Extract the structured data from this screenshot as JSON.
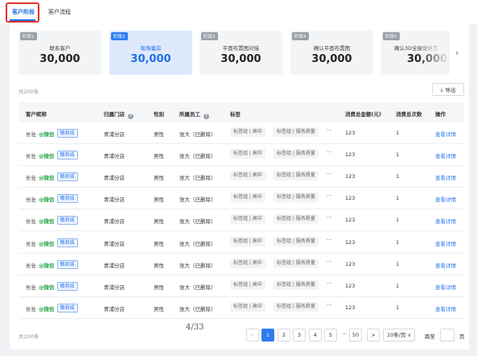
{
  "tabs": [
    {
      "label": "客户阶段",
      "active": true
    },
    {
      "label": "客户流程",
      "active": false
    }
  ],
  "stages": [
    {
      "chip": "阶段1",
      "name": "联系客户",
      "count": "30,000"
    },
    {
      "chip": "阶段2",
      "name": "现场量房",
      "count": "30,000"
    },
    {
      "chip": "阶段3",
      "name": "平面布置图对接",
      "count": "30,000"
    },
    {
      "chip": "阶段4",
      "name": "确认平面布置图",
      "count": "30,000"
    },
    {
      "chip": "阶段5",
      "name": "确认3D全屋设计方",
      "count": "30,000"
    }
  ],
  "scroll_right_icon": "chevron-right-icon",
  "total_top": "共200条",
  "export_label": "导出",
  "export_icon": "download-icon",
  "columns": {
    "customer": "客户昵称",
    "store": "归属门店",
    "gender": "性别",
    "staff": "所属员工",
    "tags": "标签",
    "amount": "消费总金额(元)",
    "times": "消费总次数",
    "action": "操作"
  },
  "rows": [
    {
      "name": "长壮",
      "channel": "@微信",
      "tag": "徽商城",
      "store": "青浦分店",
      "gender": "男性",
      "staff": "张大（已删除）",
      "tag1": "标签组 | 高中",
      "tag2": "标签组 | 服务质量",
      "more": "···",
      "amount": "123",
      "times": "1",
      "action": "查看详情"
    },
    {
      "name": "长壮",
      "channel": "@微信",
      "tag": "徽商城",
      "store": "青浦分店",
      "gender": "男性",
      "staff": "张大（已删除）",
      "tag1": "标签组 | 高中",
      "tag2": "标签组 | 服务质量",
      "more": "···",
      "amount": "123",
      "times": "1",
      "action": "查看详情"
    },
    {
      "name": "长壮",
      "channel": "@微信",
      "tag": "徽商城",
      "store": "青浦分店",
      "gender": "男性",
      "staff": "张大（已删除）",
      "tag1": "标签组 | 高中",
      "tag2": "标签组 | 服务质量",
      "more": "···",
      "amount": "123",
      "times": "1",
      "action": "查看详情"
    },
    {
      "name": "长壮",
      "channel": "@微信",
      "tag": "徽商城",
      "store": "青浦分店",
      "gender": "男性",
      "staff": "张大（已删除）",
      "tag1": "标签组 | 高中",
      "tag2": "标签组 | 服务质量",
      "more": "···",
      "amount": "123",
      "times": "1",
      "action": "查看详情"
    },
    {
      "name": "长壮",
      "channel": "@微信",
      "tag": "徽商城",
      "store": "青浦分店",
      "gender": "男性",
      "staff": "张大（已删除）",
      "tag1": "标签组 | 高中",
      "tag2": "标签组 | 服务质量",
      "more": "···",
      "amount": "123",
      "times": "1",
      "action": "查看详情"
    },
    {
      "name": "长壮",
      "channel": "@微信",
      "tag": "徽商城",
      "store": "青浦分店",
      "gender": "男性",
      "staff": "张大（已删除）",
      "tag1": "标签组 | 高中",
      "tag2": "标签组 | 服务质量",
      "more": "···",
      "amount": "123",
      "times": "1",
      "action": "查看详情"
    },
    {
      "name": "长壮",
      "channel": "@微信",
      "tag": "徽商城",
      "store": "青浦分店",
      "gender": "男性",
      "staff": "张大（已删除）",
      "tag1": "标签组 | 高中",
      "tag2": "标签组 | 服务质量",
      "more": "···",
      "amount": "123",
      "times": "1",
      "action": "查看详情"
    },
    {
      "name": "长壮",
      "channel": "@微信",
      "tag": "徽商城",
      "store": "青浦分店",
      "gender": "男性",
      "staff": "张大（已删除）",
      "tag1": "标签组 | 高中",
      "tag2": "标签组 | 服务质量",
      "more": "···",
      "amount": "123",
      "times": "1",
      "action": "查看详情"
    },
    {
      "name": "长壮",
      "channel": "@微信",
      "tag": "徽商城",
      "store": "青浦分店",
      "gender": "男性",
      "staff": "张大（已删除）",
      "tag1": "标签组 | 高中",
      "tag2": "标签组 | 服务质量",
      "more": "···",
      "amount": "123",
      "times": "1",
      "action": "查看详情"
    }
  ],
  "footer": {
    "total": "共200条",
    "page_fraction": "4/33",
    "prev": "<",
    "pages": [
      "1",
      "2",
      "3",
      "4",
      "5"
    ],
    "ellipsis": "···",
    "last_page": "50",
    "next": ">",
    "current_page": "1",
    "page_size": "10条/页 ∨",
    "jump_label": "跳至",
    "page_unit": "页"
  },
  "colors": {
    "accent": "#2f7cf0",
    "highlight_border": "#e5302a",
    "wechat": "#2aa44b"
  }
}
